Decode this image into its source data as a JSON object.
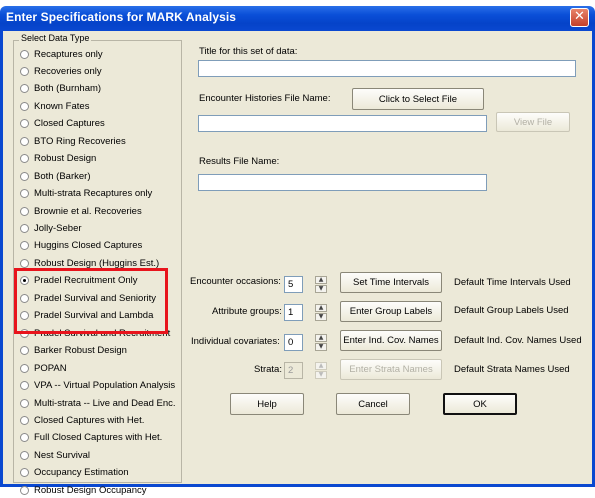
{
  "window": {
    "title": "Enter Specifications for MARK Analysis",
    "close_glyph": "✕"
  },
  "data_type": {
    "legend": "Select Data Type",
    "selected": "Pradel Recruitment Only",
    "options": [
      "Recaptures only",
      "Recoveries only",
      "Both (Burnham)",
      "Known Fates",
      "Closed Captures",
      "BTO Ring Recoveries",
      "Robust Design",
      "Both (Barker)",
      "Multi-strata Recaptures only",
      "Brownie et al. Recoveries",
      "Jolly-Seber",
      "Huggins Closed Captures",
      "Robust Design (Huggins Est.)",
      "Pradel Recruitment Only",
      "Pradel Survival and Seniority",
      "Pradel Survival and Lambda",
      "Pradel Survival and Recruitment",
      "Barker Robust Design",
      "POPAN",
      "VPA -- Virtual Population Analysis",
      "Multi-strata -- Live and Dead Enc.",
      "Closed Captures with Het.",
      "Full Closed Captures with Het.",
      "Nest Survival",
      "Occupancy Estimation",
      "Robust Design Occupancy"
    ]
  },
  "title_field": {
    "label": "Title for this set of data:",
    "value": ""
  },
  "encounter_file": {
    "label": "Encounter Histories File Name:",
    "select_button": "Click to Select File",
    "value": "",
    "view_button": "View File"
  },
  "results_file": {
    "label": "Results File Name:",
    "value": ""
  },
  "params": {
    "occasions": {
      "label": "Encounter occasions:",
      "value": "5",
      "button": "Set Time Intervals",
      "status": "Default Time Intervals Used"
    },
    "groups": {
      "label": "Attribute groups:",
      "value": "1",
      "button": "Enter Group Labels",
      "status": "Default Group Labels Used"
    },
    "covariates": {
      "label": "Individual covariates:",
      "value": "0",
      "button": "Enter Ind. Cov. Names",
      "status": "Default Ind. Cov. Names Used"
    },
    "strata": {
      "label": "Strata:",
      "value": "2",
      "button": "Enter Strata Names",
      "status": "Default Strata Names Used"
    }
  },
  "actions": {
    "help": "Help",
    "cancel": "Cancel",
    "ok": "OK"
  },
  "spin_glyphs": {
    "up": "▲",
    "down": "▼"
  },
  "icons": {
    "close": "close-icon",
    "radio": "radio-button-icon"
  }
}
